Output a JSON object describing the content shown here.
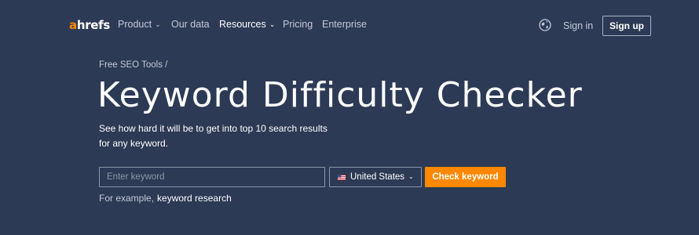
{
  "header": {
    "logo": {
      "a": "a",
      "rest": "hrefs"
    },
    "nav": [
      {
        "label": "Product",
        "dropdown": true
      },
      {
        "label": "Our data",
        "dropdown": false
      },
      {
        "label": "Resources",
        "dropdown": true
      },
      {
        "label": "Pricing",
        "dropdown": false
      },
      {
        "label": "Enterprise",
        "dropdown": false
      }
    ],
    "language_icon": "globe-icon",
    "sign_in": "Sign in",
    "sign_up": "Sign up"
  },
  "hero": {
    "breadcrumb": "Free SEO Tools /",
    "title": "Keyword Difficulty Checker",
    "subtitle": "See how hard it will be to get into top 10 search results for any keyword."
  },
  "search": {
    "placeholder": "Enter keyword",
    "value": "",
    "country": "United States",
    "country_flag": "us-flag-icon",
    "submit": "Check keyword",
    "example_prefix": "For example,",
    "example_value": "keyword research"
  },
  "colors": {
    "background": "#2c3a55",
    "accent": "#ff8800",
    "muted_text": "#c3cad8",
    "border": "#8d97aa"
  }
}
